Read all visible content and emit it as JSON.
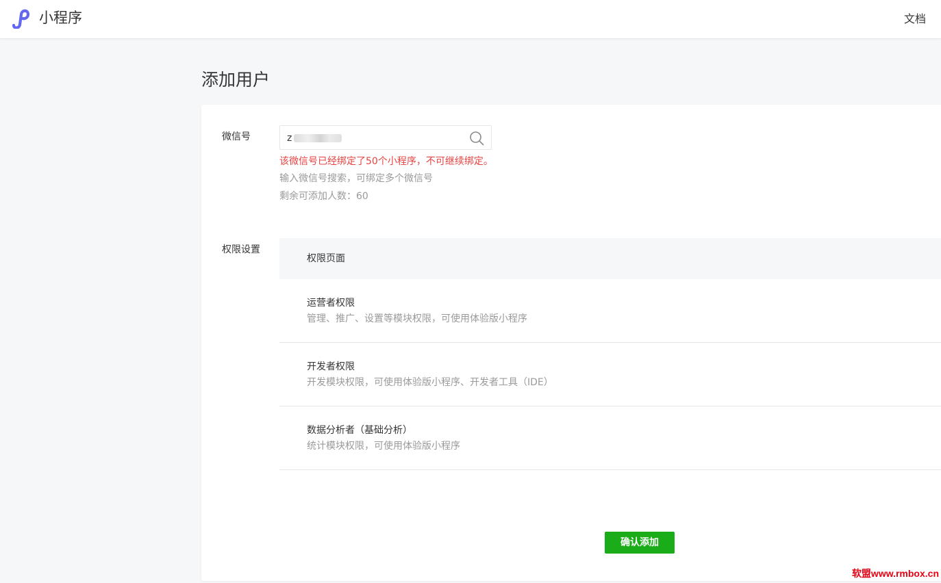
{
  "header": {
    "brand": "小程序",
    "docs_link": "文档",
    "accent_color": "#6467f0"
  },
  "page": {
    "title": "添加用户"
  },
  "form": {
    "wechat_label": "微信号",
    "search": {
      "value": "z",
      "icon": "search-icon"
    },
    "error_message": "该微信号已经绑定了50个小程序，不可继续绑定。",
    "hint_search": "输入微信号搜索，可绑定多个微信号",
    "hint_remaining": "剩余可添加人数：60",
    "permission_label": "权限设置",
    "permission_header": "权限页面",
    "permissions": [
      {
        "title": "运营者权限",
        "desc": "管理、推广、设置等模块权限，可使用体验版小程序"
      },
      {
        "title": "开发者权限",
        "desc": "开发模块权限，可使用体验版小程序、开发者工具（IDE）"
      },
      {
        "title": "数据分析者（基础分析）",
        "desc": "统计模块权限，可使用体验版小程序"
      }
    ],
    "confirm_button": "确认添加",
    "error_color": "#e64340",
    "button_color": "#1aad19"
  },
  "watermark": "软盟www.rmbox.cn"
}
